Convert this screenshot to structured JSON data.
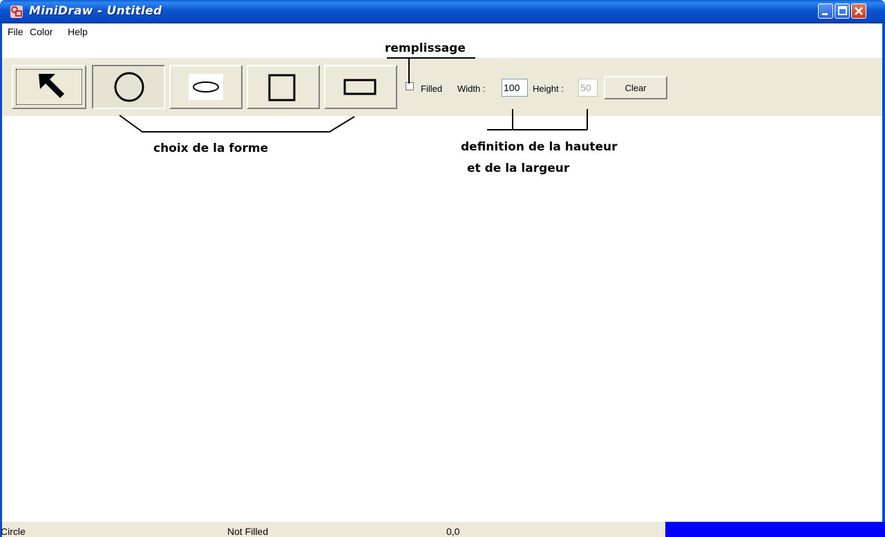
{
  "window": {
    "title": "MiniDraw - Untitled",
    "app_icon": "minidraw-app-icon",
    "controls": [
      "minimize-icon",
      "maximize-icon",
      "close-icon"
    ]
  },
  "menu": {
    "file": "File",
    "color": "Color",
    "help": "Help"
  },
  "toolbar": {
    "tools": [
      {
        "icon": "select-arrow-icon",
        "state": "focused"
      },
      {
        "icon": "circle-icon",
        "state": "pressed"
      },
      {
        "icon": "ellipse-icon",
        "state": "normal"
      },
      {
        "icon": "square-icon",
        "state": "normal"
      },
      {
        "icon": "rectangle-icon",
        "state": "normal"
      }
    ],
    "filled_label": "Filled",
    "filled_checked": false,
    "width_label": "Width :",
    "width_value": "100",
    "height_label": "Height :",
    "height_value": "50",
    "height_enabled": false,
    "clear_label": "Clear"
  },
  "annotations": {
    "fill": "remplissage",
    "shape_choice": "choix de la forme",
    "size_definition_line1": "definition de la hauteur",
    "size_definition_line2": "et de la largeur"
  },
  "status": {
    "shape": "Circle",
    "fill": "Not Filled",
    "coords": "0,0",
    "current_color": "#0000ff"
  },
  "colors": {
    "titlebar": "#0a54d0",
    "chrome": "#ece9d8",
    "canvas": "#ffffff",
    "status_color_swatch": "#0000ff"
  }
}
